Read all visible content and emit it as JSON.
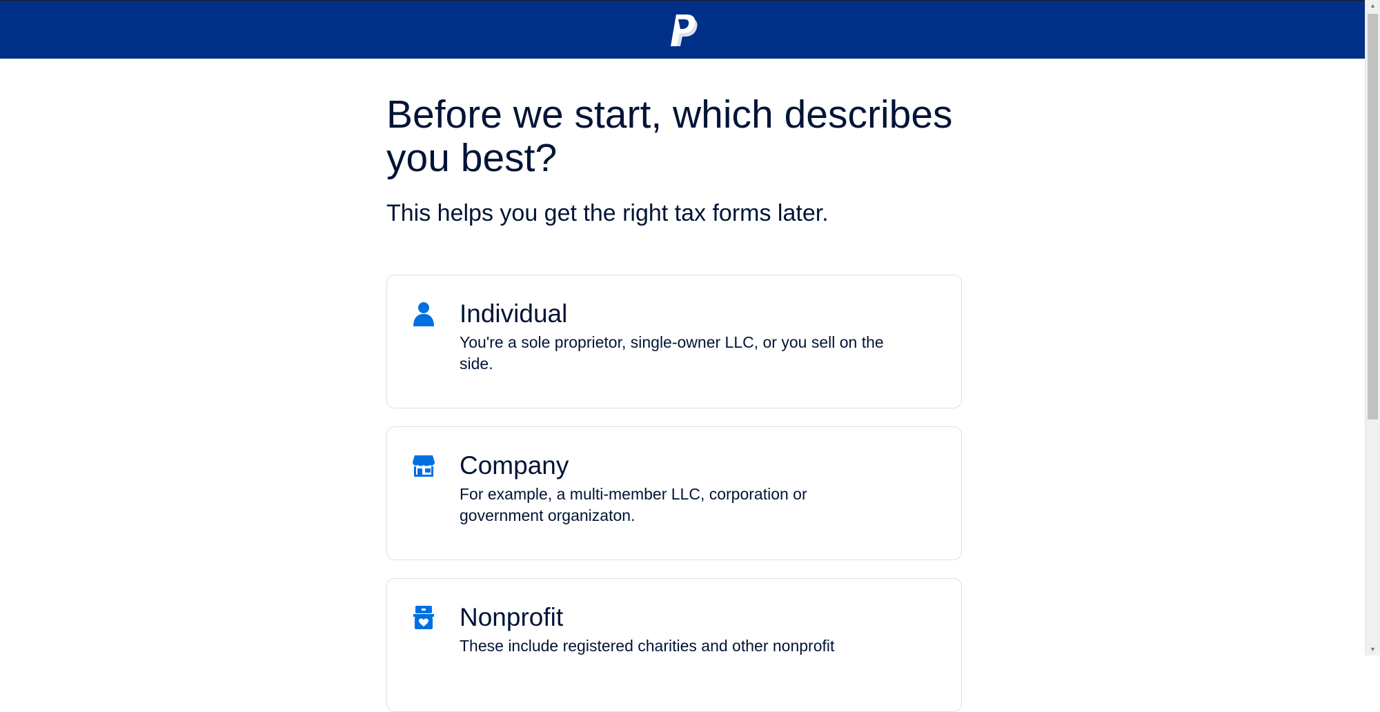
{
  "header": {
    "logo_icon": "paypal-logo-icon",
    "background_color": "#003087"
  },
  "main": {
    "title": "Before we start, which describes you best?",
    "subtitle": "This helps you get the right tax forms later."
  },
  "options": [
    {
      "icon": "person-icon",
      "title": "Individual",
      "description": "You're a sole proprietor, single-owner LLC, or you sell on the side."
    },
    {
      "icon": "storefront-icon",
      "title": "Company",
      "description": "For example, a multi-member LLC, corporation or government organizaton."
    },
    {
      "icon": "donation-box-icon",
      "title": "Nonprofit",
      "description": "These include registered charities and other nonprofit"
    }
  ],
  "colors": {
    "accent": "#0070e0",
    "text": "#001435"
  }
}
